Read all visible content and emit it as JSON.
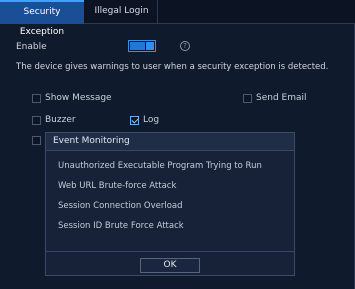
{
  "tabs": [
    {
      "label": "Security Exception",
      "active": true
    },
    {
      "label": "Illegal Login",
      "active": false
    }
  ],
  "enable": {
    "label": "Enable",
    "on": true
  },
  "help_icon": "?",
  "description": "The device gives warnings to user when a security exception is detected.",
  "options": {
    "show_message": {
      "label": "Show Message",
      "checked": false
    },
    "send_email": {
      "label": "Send Email",
      "checked": false
    },
    "buzzer": {
      "label": "Buzzer",
      "checked": false
    },
    "log": {
      "label": "Log",
      "checked": true
    }
  },
  "dialog": {
    "title": "Event Monitoring",
    "events": [
      "Unauthorized Executable Program Trying to Run",
      "Web URL Brute-force Attack",
      "Session Connection Overload",
      "Session ID Brute Force Attack"
    ],
    "ok_label": "OK"
  },
  "colors": {
    "accent": "#1a4f96",
    "toggle_on": "#2f8ef5",
    "background": "#101a2d"
  }
}
